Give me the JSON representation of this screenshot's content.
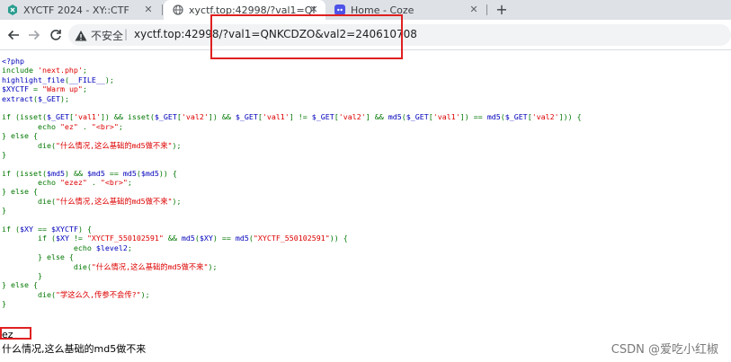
{
  "tabs": [
    {
      "title": "XYCTF 2024 - XY::CTF",
      "favicon": "ctf-logo-icon",
      "active": false
    },
    {
      "title": "xyctf.top:42998/?val1=QNKCDZO",
      "favicon": "globe-icon",
      "active": true
    },
    {
      "title": "Home - Coze",
      "favicon": "coze-logo-icon",
      "active": false
    }
  ],
  "toolbar": {
    "security_label": "不安全",
    "separator": "|",
    "url": "xyctf.top:42998/?val1=QNKCDZO&val2=240610708"
  },
  "code_lines": [
    [
      {
        "t": "<?php",
        "c": "c"
      }
    ],
    [
      {
        "t": "include ",
        "c": "k"
      },
      {
        "t": "'next.php'",
        "c": "s"
      },
      {
        "t": ";",
        "c": "k"
      }
    ],
    [
      {
        "t": "highlight_file",
        "c": "c"
      },
      {
        "t": "(",
        "c": "k"
      },
      {
        "t": "__FILE__",
        "c": "c"
      },
      {
        "t": ");",
        "c": "k"
      }
    ],
    [
      {
        "t": "$XYCTF ",
        "c": "c"
      },
      {
        "t": "= ",
        "c": "k"
      },
      {
        "t": "\"Warm up\"",
        "c": "s"
      },
      {
        "t": ";",
        "c": "k"
      }
    ],
    [
      {
        "t": "extract",
        "c": "c"
      },
      {
        "t": "(",
        "c": "k"
      },
      {
        "t": "$_GET",
        "c": "c"
      },
      {
        "t": ");",
        "c": "k"
      }
    ],
    [
      {
        "t": "",
        "c": "c"
      }
    ],
    [
      {
        "t": "if ",
        "c": "k"
      },
      {
        "t": "(isset(",
        "c": "k"
      },
      {
        "t": "$_GET",
        "c": "c"
      },
      {
        "t": "[",
        "c": "k"
      },
      {
        "t": "'val1'",
        "c": "s"
      },
      {
        "t": "]) && isset(",
        "c": "k"
      },
      {
        "t": "$_GET",
        "c": "c"
      },
      {
        "t": "[",
        "c": "k"
      },
      {
        "t": "'val2'",
        "c": "s"
      },
      {
        "t": "]) && ",
        "c": "k"
      },
      {
        "t": "$_GET",
        "c": "c"
      },
      {
        "t": "[",
        "c": "k"
      },
      {
        "t": "'val1'",
        "c": "s"
      },
      {
        "t": "] != ",
        "c": "k"
      },
      {
        "t": "$_GET",
        "c": "c"
      },
      {
        "t": "[",
        "c": "k"
      },
      {
        "t": "'val2'",
        "c": "s"
      },
      {
        "t": "] && ",
        "c": "k"
      },
      {
        "t": "md5",
        "c": "c"
      },
      {
        "t": "(",
        "c": "k"
      },
      {
        "t": "$_GET",
        "c": "c"
      },
      {
        "t": "[",
        "c": "k"
      },
      {
        "t": "'val1'",
        "c": "s"
      },
      {
        "t": "]) == ",
        "c": "k"
      },
      {
        "t": "md5",
        "c": "c"
      },
      {
        "t": "(",
        "c": "k"
      },
      {
        "t": "$_GET",
        "c": "c"
      },
      {
        "t": "[",
        "c": "k"
      },
      {
        "t": "'val2'",
        "c": "s"
      },
      {
        "t": "])) {",
        "c": "k"
      }
    ],
    [
      {
        "t": "        echo ",
        "c": "k"
      },
      {
        "t": "\"ez\" ",
        "c": "s"
      },
      {
        "t": ". ",
        "c": "k"
      },
      {
        "t": "\"<br>\"",
        "c": "s"
      },
      {
        "t": ";",
        "c": "k"
      }
    ],
    [
      {
        "t": "} else {",
        "c": "k"
      }
    ],
    [
      {
        "t": "        die",
        "c": "k"
      },
      {
        "t": "(",
        "c": "k"
      },
      {
        "t": "\"什么情况,这么基础的md5做不来\"",
        "c": "s"
      },
      {
        "t": ");",
        "c": "k"
      }
    ],
    [
      {
        "t": "}",
        "c": "k"
      }
    ],
    [
      {
        "t": "",
        "c": "c"
      }
    ],
    [
      {
        "t": "if ",
        "c": "k"
      },
      {
        "t": "(isset(",
        "c": "k"
      },
      {
        "t": "$md5",
        "c": "c"
      },
      {
        "t": ") && ",
        "c": "k"
      },
      {
        "t": "$md5 ",
        "c": "c"
      },
      {
        "t": "== ",
        "c": "k"
      },
      {
        "t": "md5",
        "c": "c"
      },
      {
        "t": "(",
        "c": "k"
      },
      {
        "t": "$md5",
        "c": "c"
      },
      {
        "t": ")) {",
        "c": "k"
      }
    ],
    [
      {
        "t": "        echo ",
        "c": "k"
      },
      {
        "t": "\"ezez\" ",
        "c": "s"
      },
      {
        "t": ". ",
        "c": "k"
      },
      {
        "t": "\"<br>\"",
        "c": "s"
      },
      {
        "t": ";",
        "c": "k"
      }
    ],
    [
      {
        "t": "} else {",
        "c": "k"
      }
    ],
    [
      {
        "t": "        die",
        "c": "k"
      },
      {
        "t": "(",
        "c": "k"
      },
      {
        "t": "\"什么情况,这么基础的md5做不来\"",
        "c": "s"
      },
      {
        "t": ");",
        "c": "k"
      }
    ],
    [
      {
        "t": "}",
        "c": "k"
      }
    ],
    [
      {
        "t": "",
        "c": "c"
      }
    ],
    [
      {
        "t": "if ",
        "c": "k"
      },
      {
        "t": "(",
        "c": "k"
      },
      {
        "t": "$XY ",
        "c": "c"
      },
      {
        "t": "== ",
        "c": "k"
      },
      {
        "t": "$XYCTF",
        "c": "c"
      },
      {
        "t": ") {",
        "c": "k"
      }
    ],
    [
      {
        "t": "        if ",
        "c": "k"
      },
      {
        "t": "(",
        "c": "k"
      },
      {
        "t": "$XY ",
        "c": "c"
      },
      {
        "t": "!= ",
        "c": "k"
      },
      {
        "t": "\"XYCTF_550102591\" ",
        "c": "s"
      },
      {
        "t": "&& ",
        "c": "k"
      },
      {
        "t": "md5",
        "c": "c"
      },
      {
        "t": "(",
        "c": "k"
      },
      {
        "t": "$XY",
        "c": "c"
      },
      {
        "t": ") == ",
        "c": "k"
      },
      {
        "t": "md5",
        "c": "c"
      },
      {
        "t": "(",
        "c": "k"
      },
      {
        "t": "\"XYCTF_550102591\"",
        "c": "s"
      },
      {
        "t": ")) {",
        "c": "k"
      }
    ],
    [
      {
        "t": "                echo ",
        "c": "k"
      },
      {
        "t": "$level2",
        "c": "c"
      },
      {
        "t": ";",
        "c": "k"
      }
    ],
    [
      {
        "t": "        } else {",
        "c": "k"
      }
    ],
    [
      {
        "t": "                die",
        "c": "k"
      },
      {
        "t": "(",
        "c": "k"
      },
      {
        "t": "\"什么情况,这么基础的md5做不来\"",
        "c": "s"
      },
      {
        "t": ");",
        "c": "k"
      }
    ],
    [
      {
        "t": "        }",
        "c": "k"
      }
    ],
    [
      {
        "t": "} else {",
        "c": "k"
      }
    ],
    [
      {
        "t": "        die",
        "c": "k"
      },
      {
        "t": "(",
        "c": "k"
      },
      {
        "t": "\"学这么久,传参不会传?\"",
        "c": "s"
      },
      {
        "t": ");",
        "c": "k"
      }
    ],
    [
      {
        "t": "}",
        "c": "k"
      }
    ]
  ],
  "output": {
    "line1": "ez",
    "line2": "什么情况,这么基础的md5做不来"
  },
  "watermark": "CSDN @爱吃小红椒",
  "colors": {
    "highlight_box": "#e02020",
    "php_keyword": "#007700",
    "php_string": "#DD0000",
    "php_default": "#0000BB"
  }
}
